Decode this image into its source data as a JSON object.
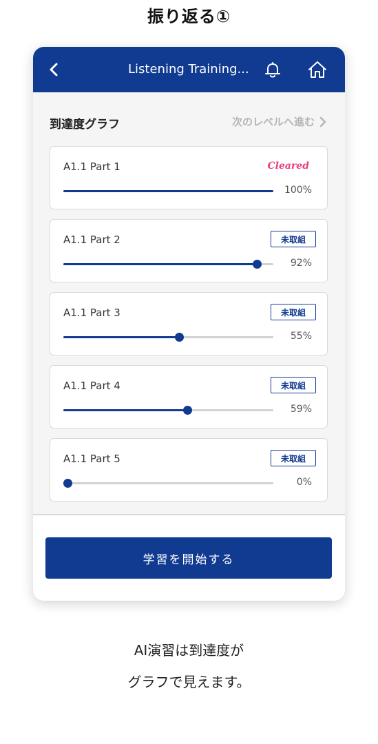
{
  "page": {
    "heading": "振り返る①",
    "caption_line1": "AI演習は到達度が",
    "caption_line2": "グラフで見えます。"
  },
  "header": {
    "title": "Listening Training...",
    "back_icon": "chevron-left-icon",
    "bell_icon": "bell-icon",
    "home_icon": "home-icon"
  },
  "graph": {
    "title": "到達度グラフ",
    "next_level_label": "次のレベルへ進む"
  },
  "cards": [
    {
      "title": "A1.1 Part 1",
      "status": "Cleared",
      "progress": 100,
      "progress_label": "100%",
      "cleared": true
    },
    {
      "title": "A1.1 Part 2",
      "status": "未取組",
      "progress": 92,
      "progress_label": "92%",
      "cleared": false
    },
    {
      "title": "A1.1 Part 3",
      "status": "未取組",
      "progress": 55,
      "progress_label": "55%",
      "cleared": false
    },
    {
      "title": "A1.1 Part 4",
      "status": "未取組",
      "progress": 59,
      "progress_label": "59%",
      "cleared": false
    },
    {
      "title": "A1.1 Part 5",
      "status": "未取組",
      "progress": 0,
      "progress_label": "0%",
      "cleared": false
    }
  ],
  "footer": {
    "start_button_label": "学習を開始する"
  },
  "colors": {
    "primary": "#113a91",
    "cleared": "#ea3d82",
    "muted": "#b5b5b5"
  }
}
